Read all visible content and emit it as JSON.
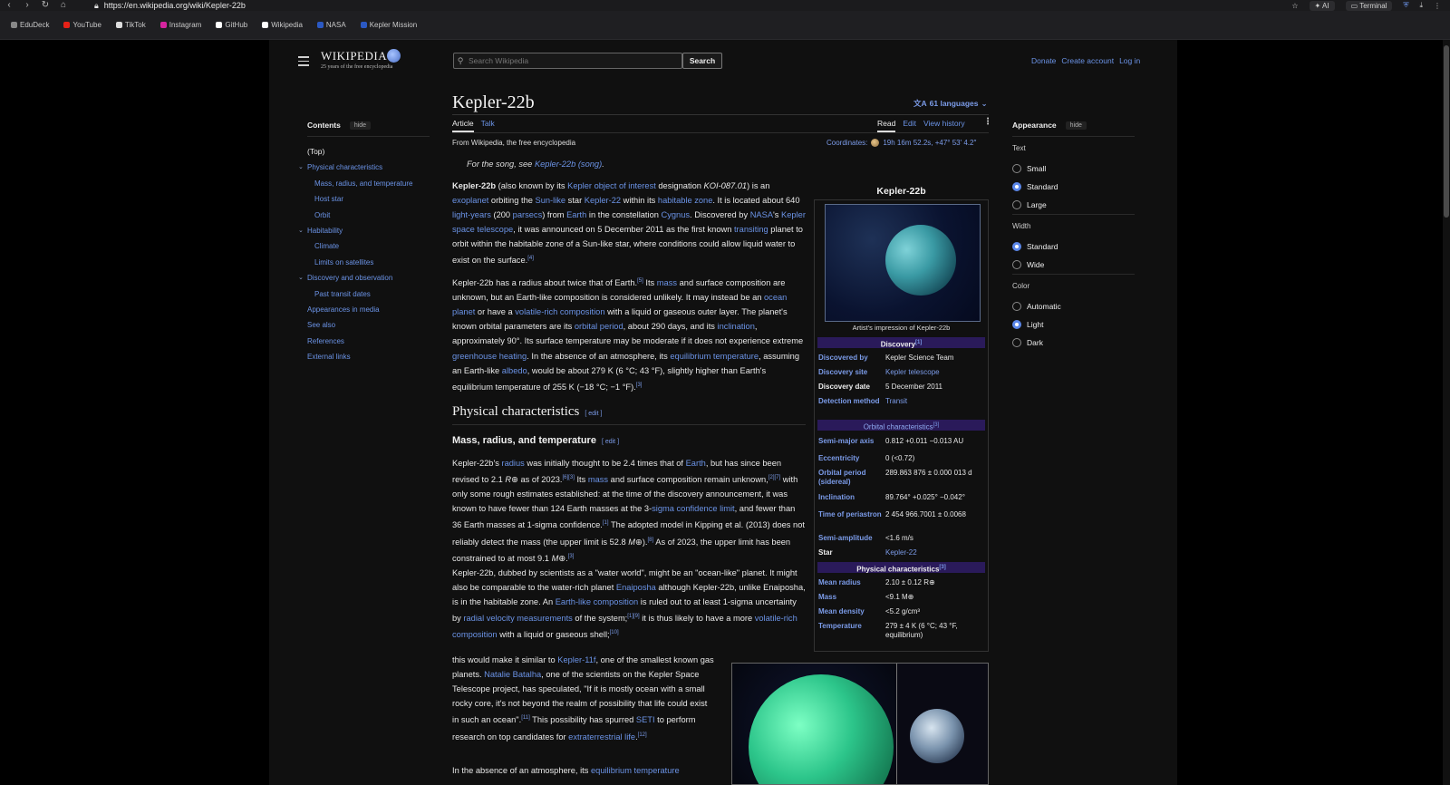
{
  "browser": {
    "url": "https://en.wikipedia.org/wiki/Kepler-22b",
    "ai_label": "AI",
    "terminal_label": "Terminal",
    "bookmarks": [
      {
        "label": "EduDeck",
        "color": "#888888"
      },
      {
        "label": "YouTube",
        "color": "#e62117"
      },
      {
        "label": "TikTok",
        "color": "#dddddd"
      },
      {
        "label": "Instagram",
        "color": "#d6249f"
      },
      {
        "label": "GitHub",
        "color": "#ffffff"
      },
      {
        "label": "Wikipedia",
        "color": "#ffffff"
      },
      {
        "label": "NASA",
        "color": "#2b59c3"
      },
      {
        "label": "Kepler Mission",
        "color": "#2b59c3"
      }
    ]
  },
  "header": {
    "logo_word": "WIKIPEDIA",
    "logo_tagline": "25 years of the free encyclopedia",
    "search_placeholder": "Search Wikipedia",
    "search_button": "Search",
    "donate": "Donate",
    "create_account": "Create account",
    "log_in": "Log in"
  },
  "toc": {
    "heading": "Contents",
    "hide": "hide",
    "items": [
      {
        "label": "(Top)",
        "level": 1
      },
      {
        "label": "Physical characteristics",
        "level": 1,
        "chevron": true
      },
      {
        "label": "Mass, radius, and temperature",
        "level": 2
      },
      {
        "label": "Host star",
        "level": 2
      },
      {
        "label": "Orbit",
        "level": 2
      },
      {
        "label": "Habitability",
        "level": 1,
        "chevron": true
      },
      {
        "label": "Climate",
        "level": 2
      },
      {
        "label": "Limits on satellites",
        "level": 2
      },
      {
        "label": "Discovery and observation",
        "level": 1,
        "chevron": true
      },
      {
        "label": "Past transit dates",
        "level": 2
      },
      {
        "label": "Appearances in media",
        "level": 1
      },
      {
        "label": "See also",
        "level": 1
      },
      {
        "label": "References",
        "level": 1
      },
      {
        "label": "External links",
        "level": 1
      }
    ]
  },
  "article": {
    "title": "Kepler-22b",
    "languages": "61 languages",
    "tab_article": "Article",
    "tab_talk": "Talk",
    "tab_read": "Read",
    "tab_edit": "Edit",
    "tab_history": "View history",
    "from": "From Wikipedia, the free encyclopedia",
    "coordinates_label": "Coordinates:",
    "coordinates_value": "19h 16m 52.2s, +47° 53′ 4.2″",
    "hatnote_prefix": "For the song, see ",
    "hatnote_link": "Kepler-22b (song)",
    "hatnote_suffix": ".",
    "h2_physical": "Physical characteristics",
    "h3_mass": "Mass, radius, and temperature",
    "edit": "[ edit ]"
  },
  "infobox": {
    "title": "Kepler-22b",
    "caption": "Artist's impression of Kepler-22b",
    "band_discovery": "Discovery",
    "band_orbital": "Orbital characteristics",
    "band_physical": "Physical characteristics",
    "rows_discovery": [
      {
        "label": "Discovered by",
        "value": "Kepler Science Team"
      },
      {
        "label": "Discovery site",
        "value": "Kepler telescope"
      },
      {
        "label": "Discovery date",
        "value": "5 December 2011"
      },
      {
        "label": "Detection method",
        "value": "Transit"
      }
    ],
    "rows_orbital": [
      {
        "label": "Semi-major axis",
        "value": "0.812 +0.011 −0.013 AU"
      },
      {
        "label": "Eccentricity",
        "value": "0 (<0.72)"
      },
      {
        "label": "Orbital period (sidereal)",
        "value": "289.863 876 ± 0.000 013 d"
      },
      {
        "label": "Inclination",
        "value": "89.764° +0.025° −0.042°"
      },
      {
        "label": "Time of periastron",
        "value": "2 454 966.7001 ± 0.0068"
      },
      {
        "label": "Semi-amplitude",
        "value": "<1.6 m/s"
      },
      {
        "label": "Star",
        "value": "Kepler-22"
      }
    ],
    "rows_physical": [
      {
        "label": "Mean radius",
        "value": "2.10 ± 0.12 R⊕"
      },
      {
        "label": "Mass",
        "value": "<9.1 M⊕"
      },
      {
        "label": "Mean density",
        "value": "<5.2 g/cm³"
      },
      {
        "label": "Temperature",
        "value": "279 ± 4 K (6 °C; 43 °F, equilibrium)"
      }
    ]
  },
  "appearance": {
    "heading": "Appearance",
    "hide": "hide",
    "text_label": "Text",
    "text_options": [
      "Small",
      "Standard",
      "Large"
    ],
    "text_selected": "Standard",
    "width_label": "Width",
    "width_options": [
      "Standard",
      "Wide"
    ],
    "width_selected": "Standard",
    "color_label": "Color",
    "color_options": [
      "Automatic",
      "Light",
      "Dark"
    ],
    "color_selected": "Light"
  },
  "colors": {
    "link": "#6b93e6",
    "band": "#2a1a5a",
    "radio_on": "#5b87ea"
  }
}
